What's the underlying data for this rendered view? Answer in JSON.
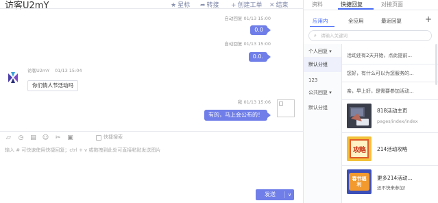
{
  "header": {
    "title": "访客U2mY",
    "toolbar": [
      {
        "label": "星标",
        "icon": "star-icon"
      },
      {
        "label": "转接",
        "icon": "transfer-icon"
      },
      {
        "label": "创建工单",
        "icon": "plus-icon"
      },
      {
        "label": "结束",
        "icon": "close-icon"
      }
    ]
  },
  "chat": {
    "messages": [
      {
        "meta": "自动回复  01/13 15:00",
        "text": "0.0"
      },
      {
        "meta": "自动回复  01/13 15:00",
        "text": "0.0."
      },
      {
        "name": "访客U2mY",
        "time": "01/13 15:04",
        "text": "你们情人节活动吗"
      },
      {
        "meta": "我  01/13 15:06",
        "text": "有的，马上会公布的！"
      }
    ]
  },
  "composer": {
    "tools": [
      "emoji-chart-icon",
      "clock-icon",
      "quick-icon",
      "smile-icon",
      "scissors-icon",
      "image-icon"
    ],
    "quick_search_label": "快捷搜索",
    "placeholder": "输入 # 可快速使用快捷回复；ctrl + v 或拖拽到此处可直接粘贴发送图片",
    "send_label": "发送"
  },
  "right_panel": {
    "tabs": [
      "资料",
      "快捷回复",
      "对接页面"
    ],
    "active_tab": 1,
    "subtabs": [
      "应用内",
      "全应用",
      "最近回复"
    ],
    "active_subtab": 0,
    "add_label": "+",
    "search_placeholder": "请输入关键词",
    "categories": [
      {
        "label": "个人回复 ▾",
        "active": false
      },
      {
        "label": "默认分组",
        "active": true
      },
      {
        "label": "123",
        "active": false
      },
      {
        "label": "公共回复 ▾",
        "active": false
      },
      {
        "label": "默认分组",
        "active": false
      }
    ],
    "replies": [
      "活动还有2天开始，点此提前...",
      "您好，有什么可以为您服务的...",
      "亲，早上好，是需要参加活动..."
    ],
    "cards": [
      {
        "title": "818活动主页",
        "subtitle": "pages/index/index",
        "thumb_text": ""
      },
      {
        "title": "214活动攻略",
        "subtitle": "",
        "thumb_text": "攻略"
      },
      {
        "title": "更多214活动...",
        "subtitle": "还不快来参加！",
        "thumb_text": "春节福利"
      }
    ]
  },
  "colors": {
    "accent": "#6f7ee8",
    "link": "#4a6cf7",
    "border": "#e6e8ee"
  }
}
